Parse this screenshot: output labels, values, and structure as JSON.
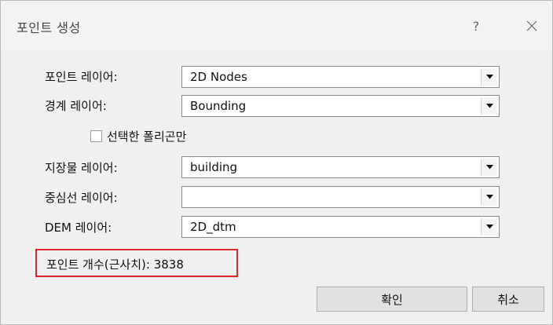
{
  "dialog": {
    "title": "포인트 생성",
    "help_glyph": "?",
    "close_icon": "close-icon"
  },
  "fields": [
    {
      "label": "포인트 레이어:",
      "value": "2D Nodes"
    },
    {
      "label": "경계 레이어:",
      "value": "Bounding"
    },
    {
      "label": "지장물 레이어:",
      "value": "building"
    },
    {
      "label": "중심선 레이어:",
      "value": ""
    },
    {
      "label": "DEM 레이어:",
      "value": "2D_dtm"
    }
  ],
  "checkbox": {
    "label": "선택한 폴리곤만",
    "checked": false
  },
  "point_count": {
    "label": "포인트 개수(근사치): 3838",
    "highlight_color": "#e0242b"
  },
  "buttons": {
    "ok_label": "확인",
    "cancel_label": "취소"
  }
}
